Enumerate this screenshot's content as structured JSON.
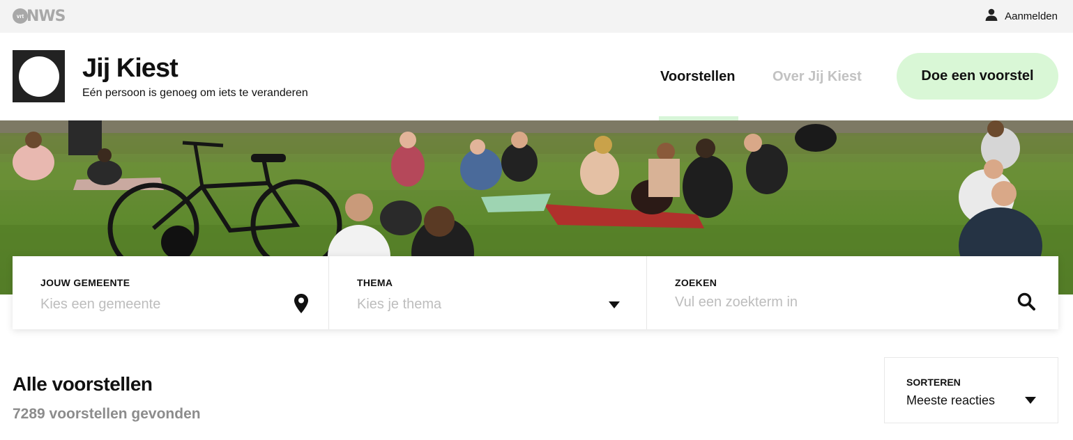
{
  "topbar": {
    "logo_small": "vrt",
    "logo_text": "NWS",
    "login_label": "Aanmelden",
    "login_icon": "user-icon"
  },
  "header": {
    "title": "Jij Kiest",
    "subtitle": "Eén persoon is genoeg om iets te veranderen",
    "nav": [
      {
        "label": "Voorstellen",
        "active": true
      },
      {
        "label": "Over Jij Kiest",
        "active": false
      }
    ],
    "cta_label": "Doe een voorstel",
    "accent_color": "#d9f7d6"
  },
  "filters": {
    "gemeente": {
      "label": "JOUW GEMEENTE",
      "placeholder": "Kies een gemeente",
      "icon": "map-pin-icon"
    },
    "thema": {
      "label": "THEMA",
      "placeholder": "Kies je thema",
      "icon": "caret-down-icon"
    },
    "zoeken": {
      "label": "ZOEKEN",
      "placeholder": "Vul een zoekterm in",
      "icon": "search-icon"
    }
  },
  "results": {
    "title": "Alle voorstellen",
    "count": "7289 voorstellen gevonden"
  },
  "sort": {
    "label": "SORTEREN",
    "value": "Meeste reacties",
    "icon": "caret-down-icon"
  }
}
